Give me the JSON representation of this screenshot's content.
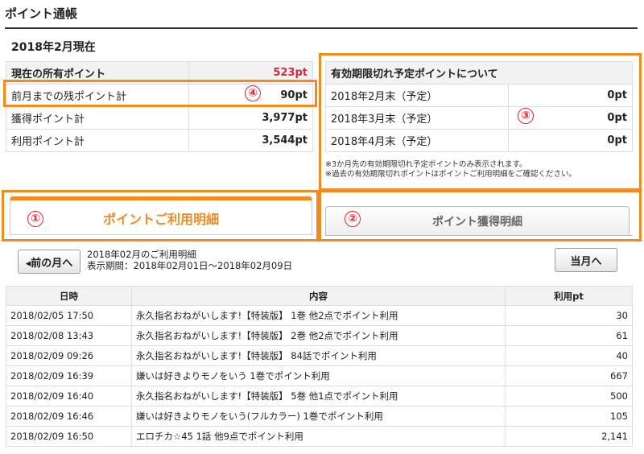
{
  "page": {
    "title": "ポイント通帳",
    "as_of": "2018年2月現在"
  },
  "summary": {
    "rows": [
      {
        "label": "現在の所有ポイント",
        "value": "523pt"
      },
      {
        "label": "前月までの残ポイント計",
        "value": "90pt"
      },
      {
        "label": "獲得ポイント計",
        "value": "3,977pt"
      },
      {
        "label": "利用ポイント計",
        "value": "3,544pt"
      }
    ]
  },
  "expiry": {
    "heading": "有効期限切れ予定ポイントについて",
    "rows": [
      {
        "label": "2018年2月末（予定）",
        "value": "0pt"
      },
      {
        "label": "2018年3月末（予定）",
        "value": "0pt"
      },
      {
        "label": "2018年4月末（予定）",
        "value": "0pt"
      }
    ],
    "notes": [
      "※3か月先の有効期限切れ予定ポイントのみ表示されます。",
      "※過去の有効期限切れポイントはポイントご利用明細をご確認ください。"
    ]
  },
  "badges": [
    "①",
    "②",
    "③",
    "④"
  ],
  "tabs": {
    "usage": "ポイントご利用明細",
    "earned": "ポイント獲得明細"
  },
  "nav": {
    "prev": "◂前の月へ",
    "current": "当月へ",
    "period_title": "2018年02月のご利用明細",
    "period_range": "表示期間：2018年02月01日～2018年02月09日"
  },
  "history": {
    "columns": [
      "日時",
      "内容",
      "利用pt"
    ],
    "rows": [
      {
        "date": "2018/02/05 17:50",
        "content": "永久指名おねがいします!【特装版】 1巻 他2点でポイント利用",
        "pt": "30"
      },
      {
        "date": "2018/02/08 13:43",
        "content": "永久指名おねがいします!【特装版】 2巻 他2点でポイント利用",
        "pt": "61"
      },
      {
        "date": "2018/02/09 09:26",
        "content": "永久指名おねがいします!【特装版】 84話でポイント利用",
        "pt": "40"
      },
      {
        "date": "2018/02/09 16:39",
        "content": "嫌いは好きよりモノをいう 1巻でポイント利用",
        "pt": "667"
      },
      {
        "date": "2018/02/09 16:40",
        "content": "永久指名おねがいします!【特装版】 5巻 他1点でポイント利用",
        "pt": "500"
      },
      {
        "date": "2018/02/09 16:46",
        "content": "嫌いは好きよりモノをいう(フルカラー) 1巻でポイント利用",
        "pt": "105"
      },
      {
        "date": "2018/02/09 16:50",
        "content": "エロチカ☆45 1話 他9点でポイント利用",
        "pt": "2,141"
      }
    ]
  },
  "colors": {
    "accent": "#f38a20",
    "badge_red": "#e8242d",
    "point_red": "#d0283f"
  }
}
